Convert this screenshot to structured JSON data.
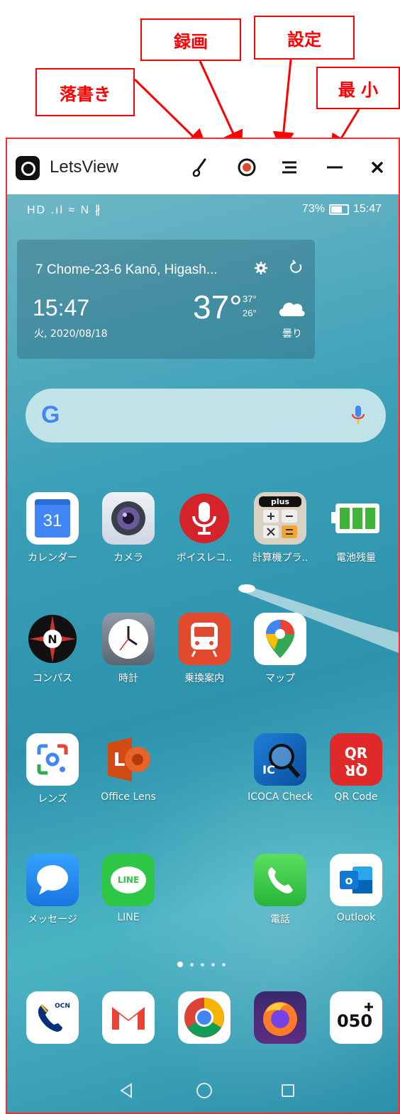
{
  "annotations": {
    "graffiti": "落書き",
    "record": "録画",
    "settings": "設定",
    "minimize": "最 小"
  },
  "window": {
    "title": "LetsView",
    "toolbar_icons": [
      "brush-icon",
      "record-icon",
      "menu-icon",
      "minimize-icon",
      "close-icon"
    ],
    "frame_color": "#ff2a2a"
  },
  "status_bar": {
    "left": "HD .ıl ≈ N ∦",
    "battery": "73%",
    "time": "15:47"
  },
  "weather": {
    "location": "7 Chome-23-6 Kanō, Higash...",
    "time": "15:47",
    "date": "火, 2020/08/18",
    "temp": "37°",
    "high": "37°",
    "low": "26°",
    "condition": "曇り"
  },
  "search": {
    "logo": "G"
  },
  "apps": {
    "calendar": {
      "label": "カレンダー",
      "day": "31"
    },
    "camera": {
      "label": "カメラ"
    },
    "voice": {
      "label": "ボイスレコ.."
    },
    "calc": {
      "label": "計算機プラ..",
      "badge": "plus"
    },
    "battery": {
      "label": "電池残量"
    },
    "compass": {
      "label": "コンパス",
      "letter": "N"
    },
    "clock": {
      "label": "時計"
    },
    "transit": {
      "label": "乗換案内"
    },
    "maps": {
      "label": "マップ"
    },
    "lens": {
      "label": "レンズ"
    },
    "office_lens": {
      "label": "Office Lens",
      "letter": "L"
    },
    "icoca": {
      "label": "ICOCA Check",
      "letters": "IC"
    },
    "qr": {
      "label": "QR Code",
      "letters": "QR"
    },
    "messages": {
      "label": "メッセージ"
    },
    "line": {
      "label": "LINE",
      "badge": "LINE"
    },
    "phone": {
      "label": "電話"
    },
    "outlook": {
      "label": "Outlook",
      "letter": "o"
    }
  },
  "dock": {
    "ocn_badge": "OCN",
    "n050": "050"
  },
  "colors": {
    "annotation": "#ff0000",
    "wallpaper": "#3aa0b8"
  }
}
